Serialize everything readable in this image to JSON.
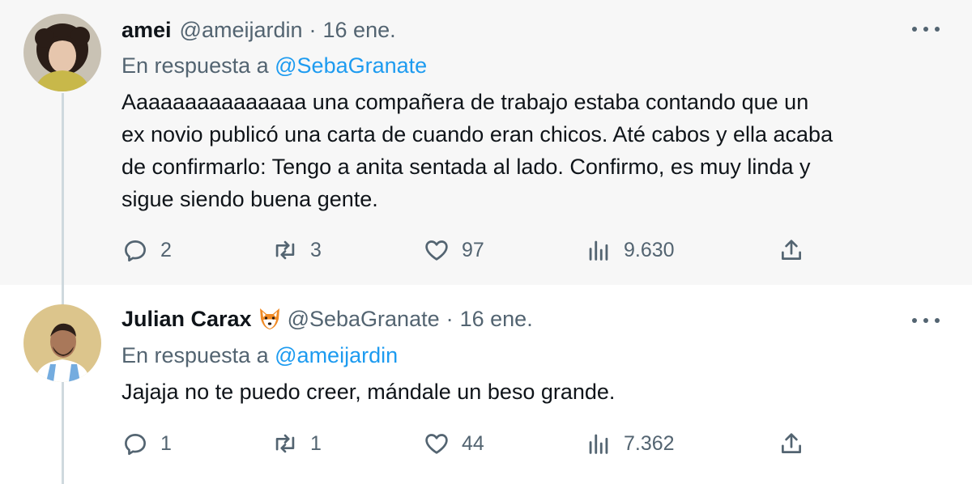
{
  "tweets": [
    {
      "name": "amei",
      "handle": "@ameijardin",
      "separator": "·",
      "date": "16 ene.",
      "reply_prefix": "En respuesta a",
      "reply_to": "@SebaGranate",
      "text_lines": [
        "Aaaaaaaaaaaaaaa una compañera de trabajo estaba contando que un",
        "ex novio publicó una carta de cuando eran chicos. Até cabos y ella acaba",
        "de confirmarlo: Tengo a anita sentada al lado. Confirmo, es muy linda y",
        "sigue siendo buena gente."
      ],
      "replies": "2",
      "retweets": "3",
      "likes": "97",
      "views": "9.630"
    },
    {
      "name": "Julian Carax",
      "name_emoji": "fox-face-icon",
      "handle": "@SebaGranate",
      "separator": "·",
      "date": "16 ene.",
      "reply_prefix": "En respuesta a",
      "reply_to": "@ameijardin",
      "text_lines": [
        "Jajaja no te puedo creer, mándale un beso grande."
      ],
      "replies": "1",
      "retweets": "1",
      "likes": "44",
      "views": "7.362"
    }
  ],
  "colors": {
    "secondary_text": "#536471",
    "link": "#1d9bf0",
    "thread_line": "#cfd9de",
    "highlight_bg": "#f7f7f7"
  }
}
